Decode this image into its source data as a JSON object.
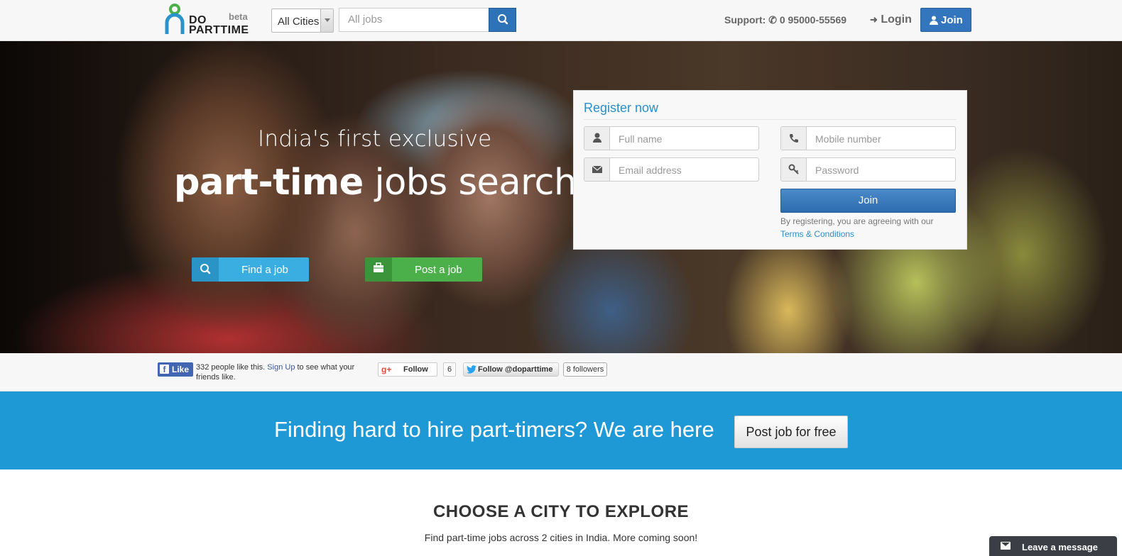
{
  "header": {
    "logo_top": "DO",
    "logo_bottom": "PARTTIME",
    "logo_badge": "beta",
    "city_select_value": "All Cities",
    "search_placeholder": "All jobs",
    "support_label": "Support:",
    "support_phone": "0 95000-55569",
    "login_label": "Login",
    "join_label": "Join"
  },
  "hero": {
    "line1": "India's first exclusive",
    "line2_bold": "part-time",
    "line2_rest": "jobs search",
    "find_job_label": "Find a job",
    "post_job_label": "Post a job"
  },
  "register": {
    "title": "Register now",
    "fullname_placeholder": "Full name",
    "mobile_placeholder": "Mobile number",
    "email_placeholder": "Email address",
    "password_placeholder": "Password",
    "join_label": "Join",
    "note": "By registering, you are agreeing with our",
    "terms_label": "Terms & Conditions"
  },
  "social": {
    "fb_like_label": "Like",
    "fb_count_text": "332 people like this.",
    "fb_signup": "Sign Up",
    "fb_rest": "to see what your friends like.",
    "gplus_follow": "Follow",
    "gplus_count": "6",
    "twitter_follow": "Follow @doparttime",
    "twitter_count": "8 followers"
  },
  "banner": {
    "text": "Finding hard to hire part-timers? We are here",
    "button_label": "Post job for free"
  },
  "cities": {
    "title": "CHOOSE A CITY TO EXPLORE",
    "subtitle": "Find part-time jobs across 2 cities in India. More coming soon!"
  },
  "chat": {
    "label": "Leave a message"
  },
  "colors": {
    "brand_blue": "#2e72b7",
    "banner_blue": "#1f98d6",
    "find_button": "#3aaee0",
    "post_button": "#4cb04a",
    "logo_green": "#4cb04a"
  }
}
